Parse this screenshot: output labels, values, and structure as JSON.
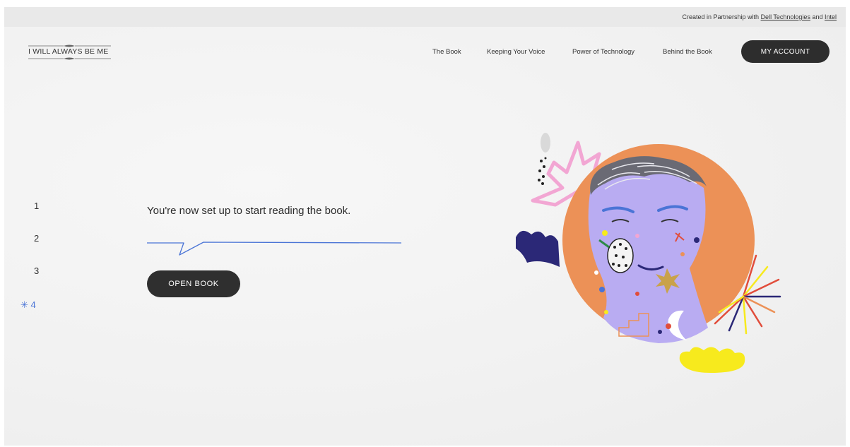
{
  "partner_bar": {
    "prefix": "Created in Partnership with ",
    "partner1": "Dell Technologies",
    "conjunction": " and ",
    "partner2": "Intel"
  },
  "logo": {
    "text": "I WILL ALWAYS BE ME"
  },
  "nav": {
    "items": [
      "The Book",
      "Keeping Your Voice",
      "Power of Technology",
      "Behind the Book"
    ],
    "account_label": "MY ACCOUNT"
  },
  "steps": {
    "items": [
      "1",
      "2",
      "3",
      "4"
    ],
    "active_marker": "✳"
  },
  "main": {
    "message": "You're now set up to start reading the book.",
    "button_label": "OPEN BOOK"
  },
  "colors": {
    "accent_blue": "#4a74d6",
    "dark_button": "#2d2d2d",
    "portrait_orange": "#ec9157",
    "face_lavender": "#b9acf2",
    "yellow": "#f7ea1d"
  }
}
